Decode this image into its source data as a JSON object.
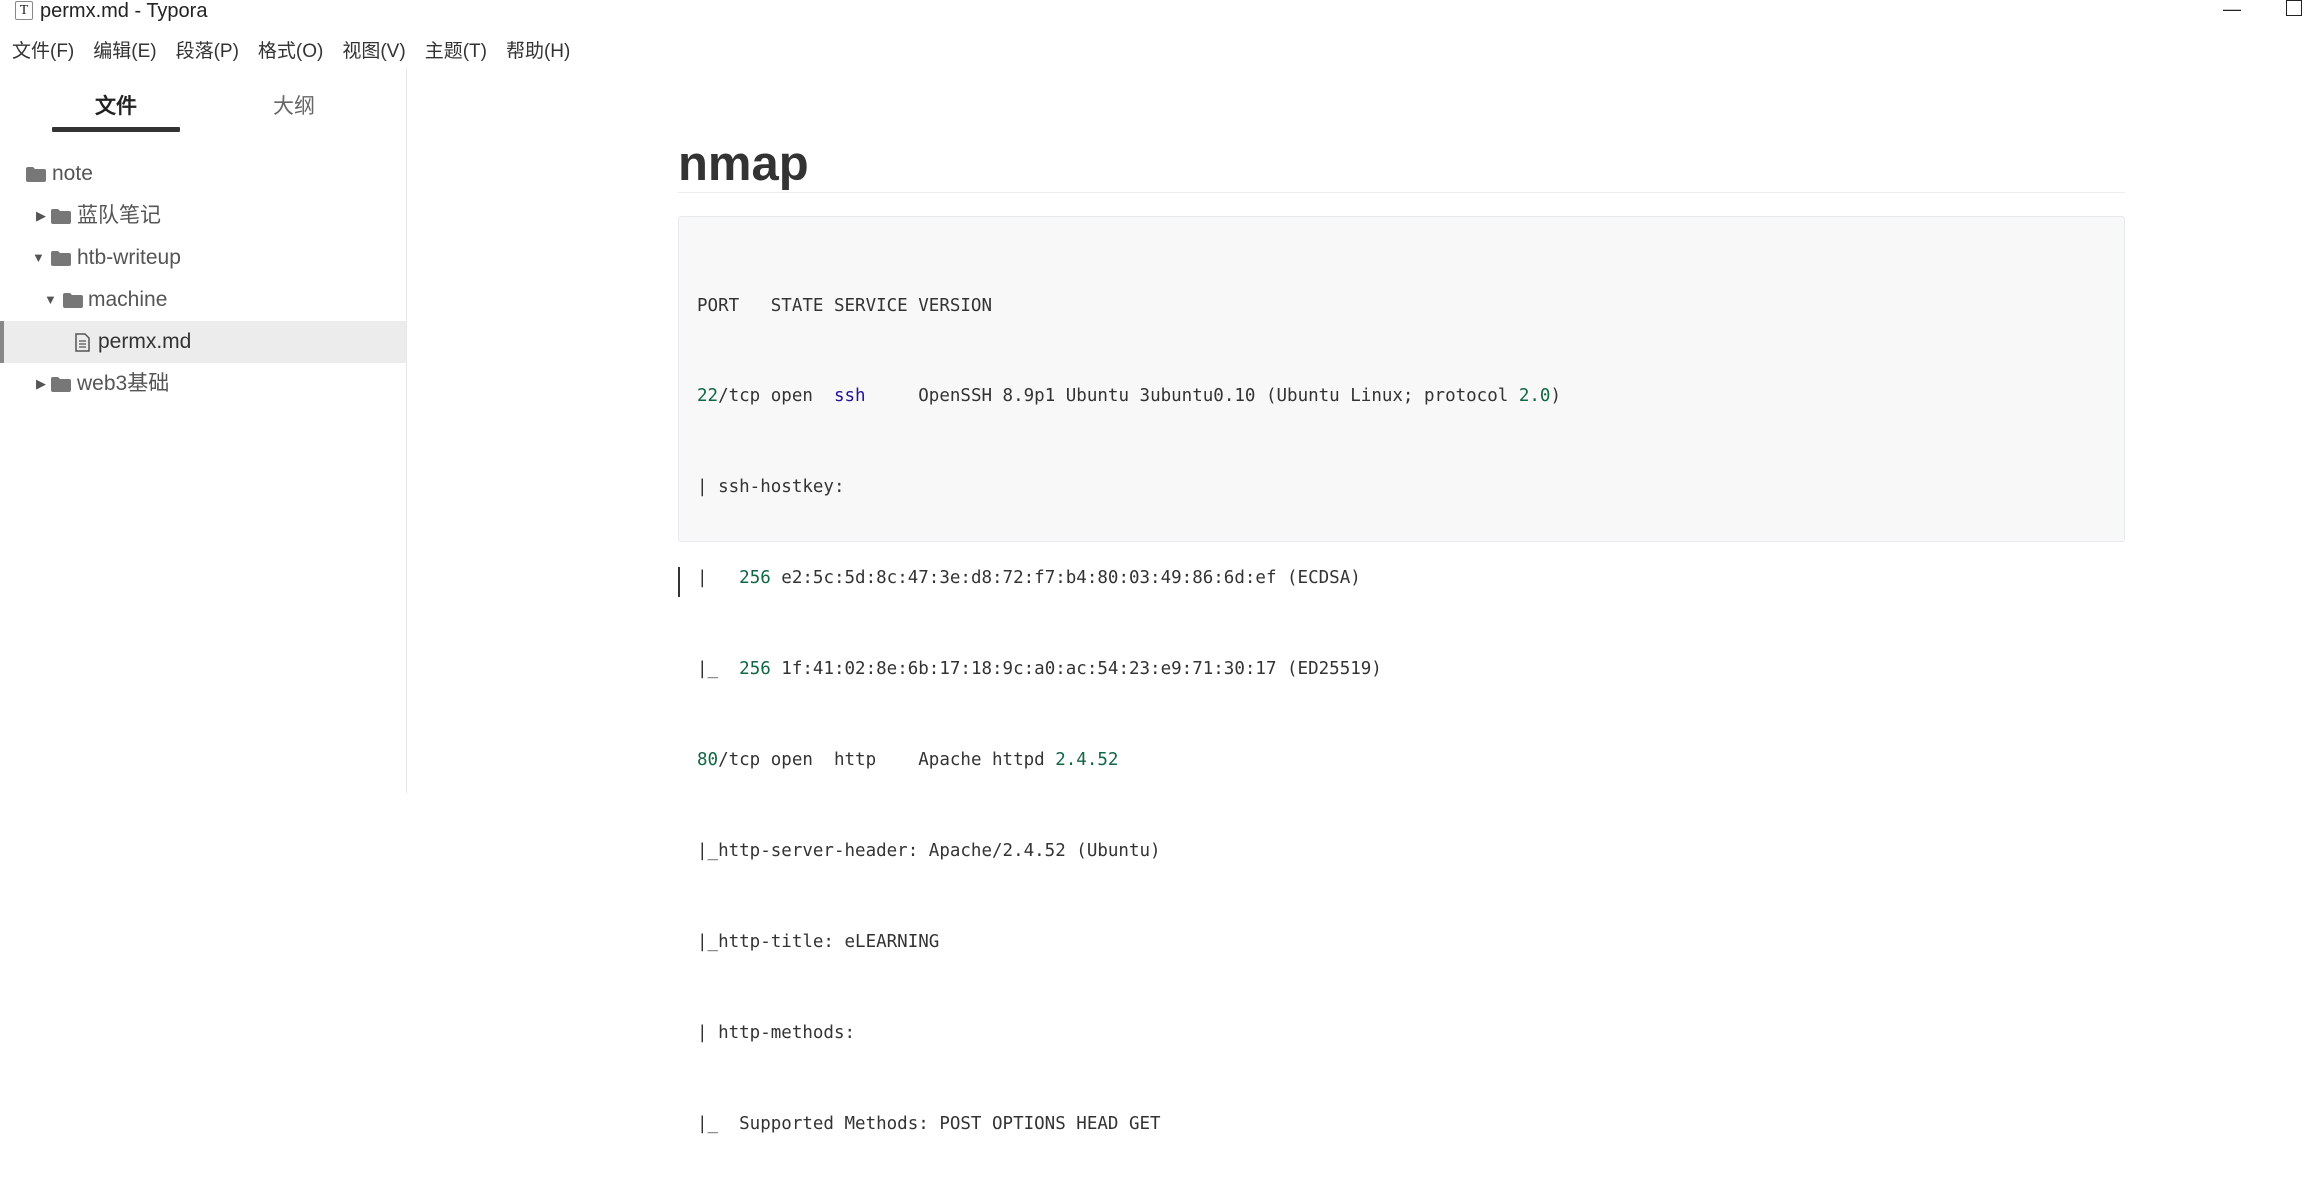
{
  "window": {
    "app_icon_glyph": "T",
    "title": "permx.md - Typora",
    "minimize_glyph": "—"
  },
  "menu": {
    "items": [
      "文件(F)",
      "编辑(E)",
      "段落(P)",
      "格式(O)",
      "视图(V)",
      "主题(T)",
      "帮助(H)"
    ]
  },
  "sidebar": {
    "tabs": {
      "files": "文件",
      "outline": "大纲"
    },
    "tree": [
      {
        "label": "note",
        "type": "folder",
        "depth": 0,
        "arrow": ""
      },
      {
        "label": "蓝队笔记",
        "type": "folder",
        "depth": 1,
        "arrow": "▶"
      },
      {
        "label": "htb-writeup",
        "type": "folder",
        "depth": 1,
        "arrow": "▼"
      },
      {
        "label": "machine",
        "type": "folder",
        "depth": 2,
        "arrow": "▼"
      },
      {
        "label": "permx.md",
        "type": "file",
        "depth": 3,
        "arrow": "",
        "selected": true
      },
      {
        "label": "web3基础",
        "type": "folder",
        "depth": 1,
        "arrow": "▶"
      }
    ]
  },
  "editor": {
    "heading": "nmap",
    "code_lines": [
      "PORT   STATE SERVICE VERSION",
      "22/tcp open  ssh     OpenSSH 8.9p1 Ubuntu 3ubuntu0.10 (Ubuntu Linux; protocol 2.0)",
      "| ssh-hostkey: ",
      "|   256 e2:5c:5d:8c:47:3e:d8:72:f7:b4:80:03:49:86:6d:ef (ECDSA)",
      "|_  256 1f:41:02:8e:6b:17:18:9c:a0:ac:54:23:e9:71:30:17 (ED25519)",
      "80/tcp open  http    Apache httpd 2.4.52",
      "|_http-server-header: Apache/2.4.52 (Ubuntu)",
      "|_http-title: eLEARNING",
      "| http-methods: ",
      "|_  Supported Methods: POST OPTIONS HEAD GET"
    ]
  },
  "colors": {
    "number": "#116644",
    "keyword": "#221199",
    "icon": "#777777"
  }
}
